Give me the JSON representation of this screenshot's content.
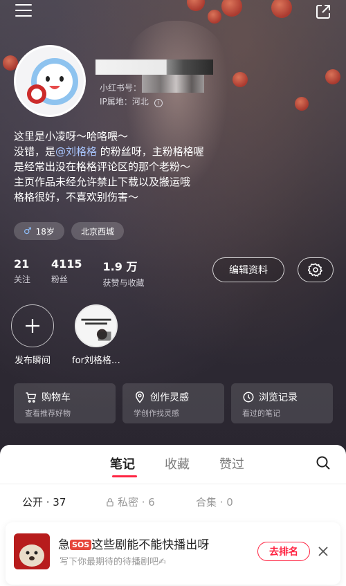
{
  "profile": {
    "id_label": "小红书号：",
    "ip_label": "IP属地：河北",
    "bio_lines": {
      "l1": "这里是小凌呀～哈咯喂～",
      "l2_pre": "没错，是",
      "l2_mention": "@刘格格",
      "l2_post": " 的粉丝呀，主粉格格喔",
      "l3": "是经常出没在格格评论区的那个老粉～",
      "l4": "主页作品未经允许禁止下载以及搬运哦",
      "l5": "格格很好，不喜欢别伤害～"
    },
    "tags": {
      "age": "18岁",
      "location": "北京西城"
    }
  },
  "stats": [
    {
      "num": "21",
      "label": "关注"
    },
    {
      "num": "4115",
      "label": "粉丝"
    },
    {
      "num": "1.9 万",
      "label": "获赞与收藏"
    }
  ],
  "buttons": {
    "edit": "编辑资料"
  },
  "moments": {
    "add_label": "发布瞬间",
    "story_label": "for刘格格…"
  },
  "shortcuts": [
    {
      "title": "购物车",
      "sub": "查看推荐好物",
      "icon": "cart-icon"
    },
    {
      "title": "创作灵感",
      "sub": "学创作找灵感",
      "icon": "location-pin-icon"
    },
    {
      "title": "浏览记录",
      "sub": "看过的笔记",
      "icon": "clock-icon"
    }
  ],
  "tabs": {
    "notes": "笔记",
    "collect": "收藏",
    "liked": "赞过"
  },
  "subtabs": {
    "public": "公开 · 37",
    "private": "私密 · 6",
    "collection": "合集 · 0"
  },
  "promo": {
    "title_pre": "急",
    "sos": "SOS",
    "title_post": "这些剧能不能快播出呀",
    "sub": "写下你最期待的待播剧吧✍",
    "button": "去排名"
  },
  "colors": {
    "accent": "#ff2442",
    "mention": "#a9c6ff"
  }
}
